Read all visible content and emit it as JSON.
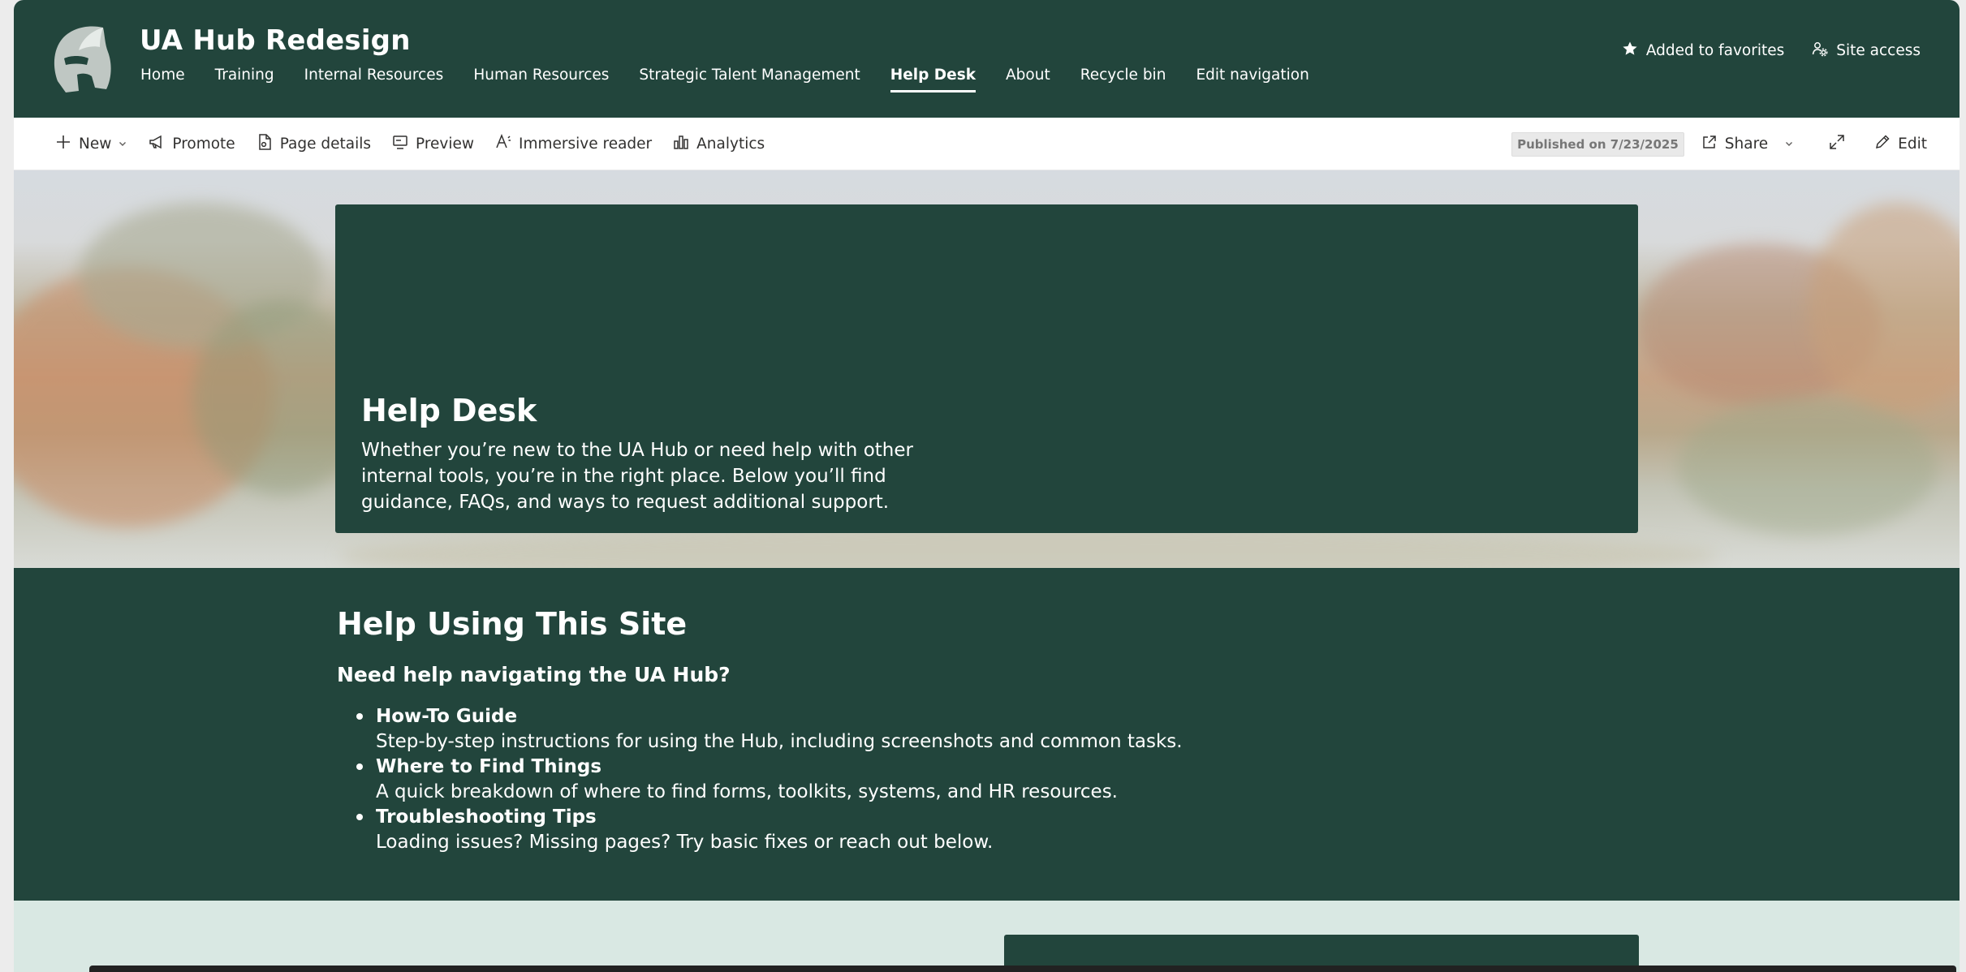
{
  "site": {
    "title": "UA Hub Redesign"
  },
  "nav": {
    "items": [
      {
        "label": "Home",
        "active": false
      },
      {
        "label": "Training",
        "active": false
      },
      {
        "label": "Internal Resources",
        "active": false
      },
      {
        "label": "Human Resources",
        "active": false
      },
      {
        "label": "Strategic Talent Management",
        "active": false
      },
      {
        "label": "Help Desk",
        "active": true
      },
      {
        "label": "About",
        "active": false
      },
      {
        "label": "Recycle bin",
        "active": false
      },
      {
        "label": "Edit navigation",
        "active": false
      }
    ]
  },
  "header_actions": {
    "favorites_label": "Added to favorites",
    "site_access_label": "Site access"
  },
  "command_bar": {
    "new_label": "New",
    "promote_label": "Promote",
    "page_details_label": "Page details",
    "preview_label": "Preview",
    "immersive_reader_label": "Immersive reader",
    "analytics_label": "Analytics",
    "published_label": "Published on 7/23/2025",
    "share_label": "Share",
    "edit_label": "Edit"
  },
  "hero": {
    "title": "Help Desk",
    "description": "Whether you’re new to the UA Hub or need help with other internal tools, you’re in the right place. Below you’ll find guidance, FAQs, and ways to request additional support."
  },
  "help": {
    "heading": "Help Using This Site",
    "subheading": "Need help navigating the UA Hub?",
    "items": [
      {
        "title": "How-To Guide",
        "desc": "Step-by-step instructions for using the Hub, including screenshots and common tasks."
      },
      {
        "title": "Where to Find Things",
        "desc": "A quick breakdown of where to find forms, toolkits, systems, and HR resources."
      },
      {
        "title": "Troubleshooting Tips",
        "desc": "Loading issues? Missing pages? Try basic fixes or reach out below."
      }
    ]
  },
  "colors": {
    "brand_green": "#22453c",
    "light_section": "#d9e8e3"
  },
  "icons": {
    "logo": "spartan-helmet-logo",
    "favorites": "star-icon",
    "site_access": "people-settings-icon",
    "new": "plus-icon",
    "promote": "megaphone-icon",
    "page_details": "page-details-icon",
    "preview": "preview-icon",
    "immersive_reader": "immersive-reader-icon",
    "analytics": "analytics-icon",
    "share": "share-icon",
    "expand": "expand-icon",
    "edit": "pencil-icon"
  }
}
